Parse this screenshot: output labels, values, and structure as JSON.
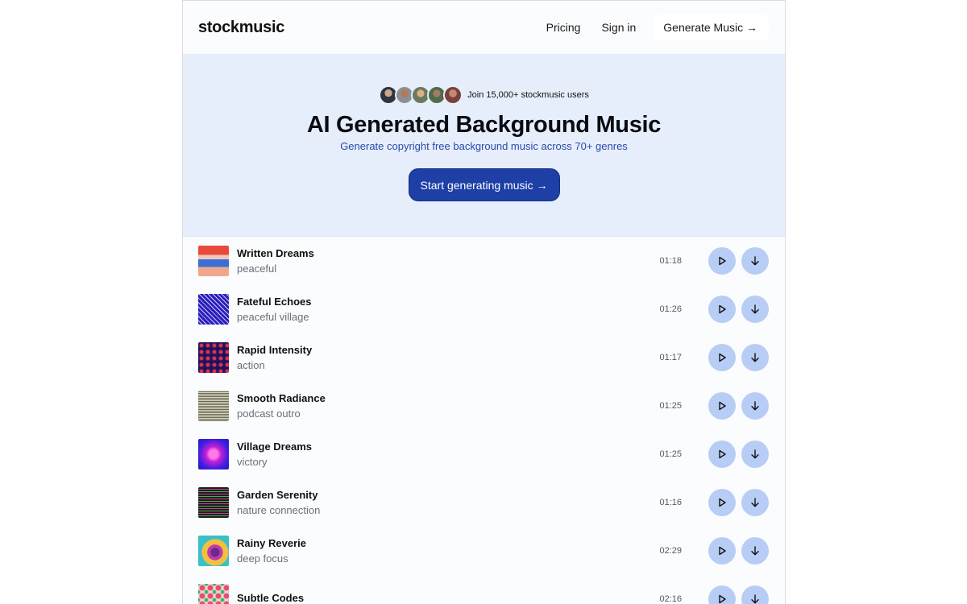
{
  "nav": {
    "logo": "stockmusic",
    "links": [
      "Pricing",
      "Sign in"
    ],
    "cta": "Generate Music →"
  },
  "hero": {
    "social_text": "Join 15,000+ stockmusic users",
    "title": "AI Generated Background Music",
    "subtitle": "Generate copyright free background music across 70+ genres",
    "button": "Start generating music →"
  },
  "tracks": [
    {
      "title": "Written Dreams",
      "tag": "peaceful",
      "duration": "01:18"
    },
    {
      "title": "Fateful Echoes",
      "tag": "peaceful village",
      "duration": "01:26"
    },
    {
      "title": "Rapid Intensity",
      "tag": "action",
      "duration": "01:17"
    },
    {
      "title": "Smooth Radiance",
      "tag": "podcast outro",
      "duration": "01:25"
    },
    {
      "title": "Village Dreams",
      "tag": "victory",
      "duration": "01:25"
    },
    {
      "title": "Garden Serenity",
      "tag": "nature connection",
      "duration": "01:16"
    },
    {
      "title": "Rainy Reverie",
      "tag": "deep focus",
      "duration": "02:29"
    },
    {
      "title": "Subtle Codes",
      "tag": "",
      "duration": "02:16"
    }
  ],
  "colors": {
    "accent": "#1d3fa6",
    "hero_bg": "#e6eefb",
    "round_button": "#b8cdf6"
  }
}
